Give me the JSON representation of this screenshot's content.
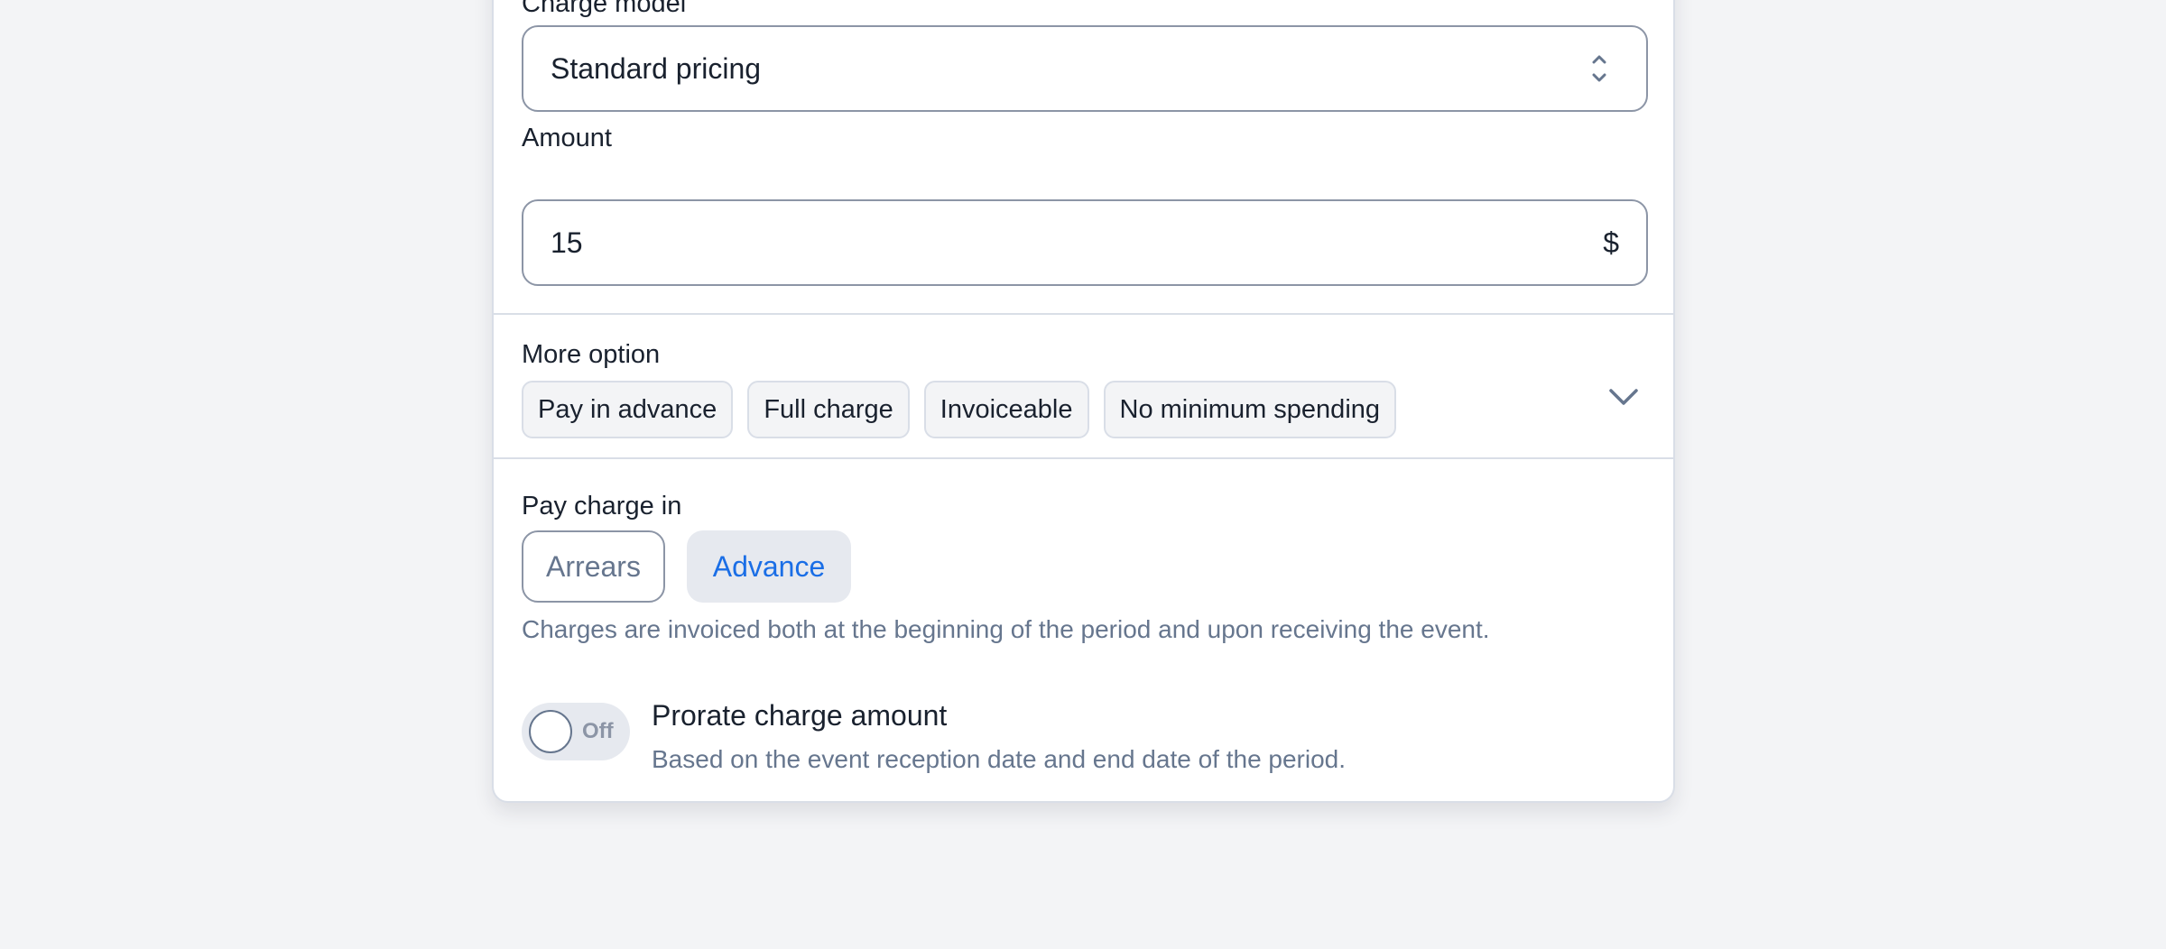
{
  "charge_model": {
    "label": "Charge model",
    "selected": "Standard pricing",
    "icon": "chevron-up-down-icon"
  },
  "amount": {
    "label": "Amount",
    "value": "15",
    "currency": "$"
  },
  "more_options": {
    "label": "More option",
    "chips": [
      "Pay in advance",
      "Full charge",
      "Invoiceable",
      "No minimum spending"
    ],
    "expand_icon": "chevron-down-icon"
  },
  "pay_charge": {
    "label": "Pay charge in",
    "options": [
      "Arrears",
      "Advance"
    ],
    "selected": "Advance",
    "help": "Charges are invoiced both at the beginning of the period and upon receiving the event."
  },
  "prorate": {
    "toggle_state": "Off",
    "title": "Prorate charge amount",
    "description": "Based on the event reception date and end date of the period."
  },
  "colors": {
    "accent": "#1a6ee6",
    "muted_text": "#66768e",
    "border": "#8c95a6",
    "background": "#f3f4f6"
  }
}
